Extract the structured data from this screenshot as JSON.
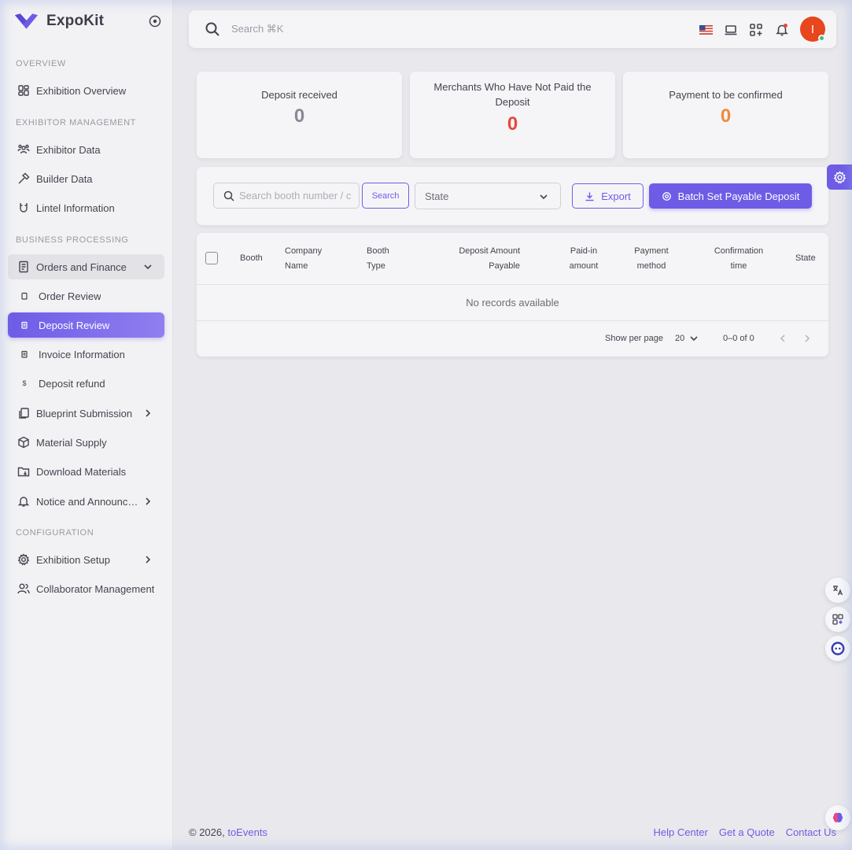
{
  "brand": {
    "name": "ExpoKit",
    "accent": "#6e5ce6"
  },
  "sidebar": {
    "sections": {
      "overview": "OVERVIEW",
      "exhibitor": "EXHIBITOR MANAGEMENT",
      "business": "BUSINESS PROCESSING",
      "configuration": "CONFIGURATION"
    },
    "items": {
      "exhibition_overview": "Exhibition Overview",
      "exhibitor_data": "Exhibitor Data",
      "builder_data": "Builder Data",
      "lintel_information": "Lintel Information",
      "orders_finance": "Orders and Finance",
      "order_review": "Order Review",
      "deposit_review": "Deposit Review",
      "invoice_information": "Invoice Information",
      "deposit_refund": "Deposit refund",
      "blueprint": "Blueprint Submission",
      "material_supply": "Material Supply",
      "download_materials": "Download Materials",
      "notice": "Notice and Announcement",
      "exhibition_setup": "Exhibition Setup",
      "collaborator": "Collaborator Management"
    }
  },
  "topbar": {
    "search_placeholder": "Search ⌘K",
    "avatar_initial": "I"
  },
  "stats": [
    {
      "title": "Deposit received",
      "value": "0",
      "color": "#8a8893"
    },
    {
      "title": "Merchants Who Have Not Paid the Deposit",
      "value": "0",
      "color": "#e5483a"
    },
    {
      "title": "Payment to be confirmed",
      "value": "0",
      "color": "#f08a3c"
    }
  ],
  "filters": {
    "search_placeholder": "Search booth number / company name",
    "search_button": "Search",
    "state_placeholder": "State",
    "export_button": "Export",
    "batch_button": "Batch Set Payable Deposit"
  },
  "table": {
    "columns": {
      "booth": "Booth",
      "company_a": "Company",
      "company_b": "Name",
      "type_a": "Booth",
      "type_b": "Type",
      "deposit_a": "Deposit Amount",
      "deposit_b": "Payable",
      "paid_a": "Paid-in",
      "paid_b": "amount",
      "method_a": "Payment",
      "method_b": "method",
      "conf_a": "Confirmation",
      "conf_b": "time",
      "state": "State"
    },
    "empty_text": "No records available",
    "pagination": {
      "label": "Show per page",
      "per_page": "20",
      "range": "0–0 of 0"
    }
  },
  "footer": {
    "copyright": "© 2026, ",
    "company": "toEvents",
    "links": {
      "help": "Help Center",
      "quote": "Get a Quote",
      "contact": "Contact Us"
    }
  }
}
